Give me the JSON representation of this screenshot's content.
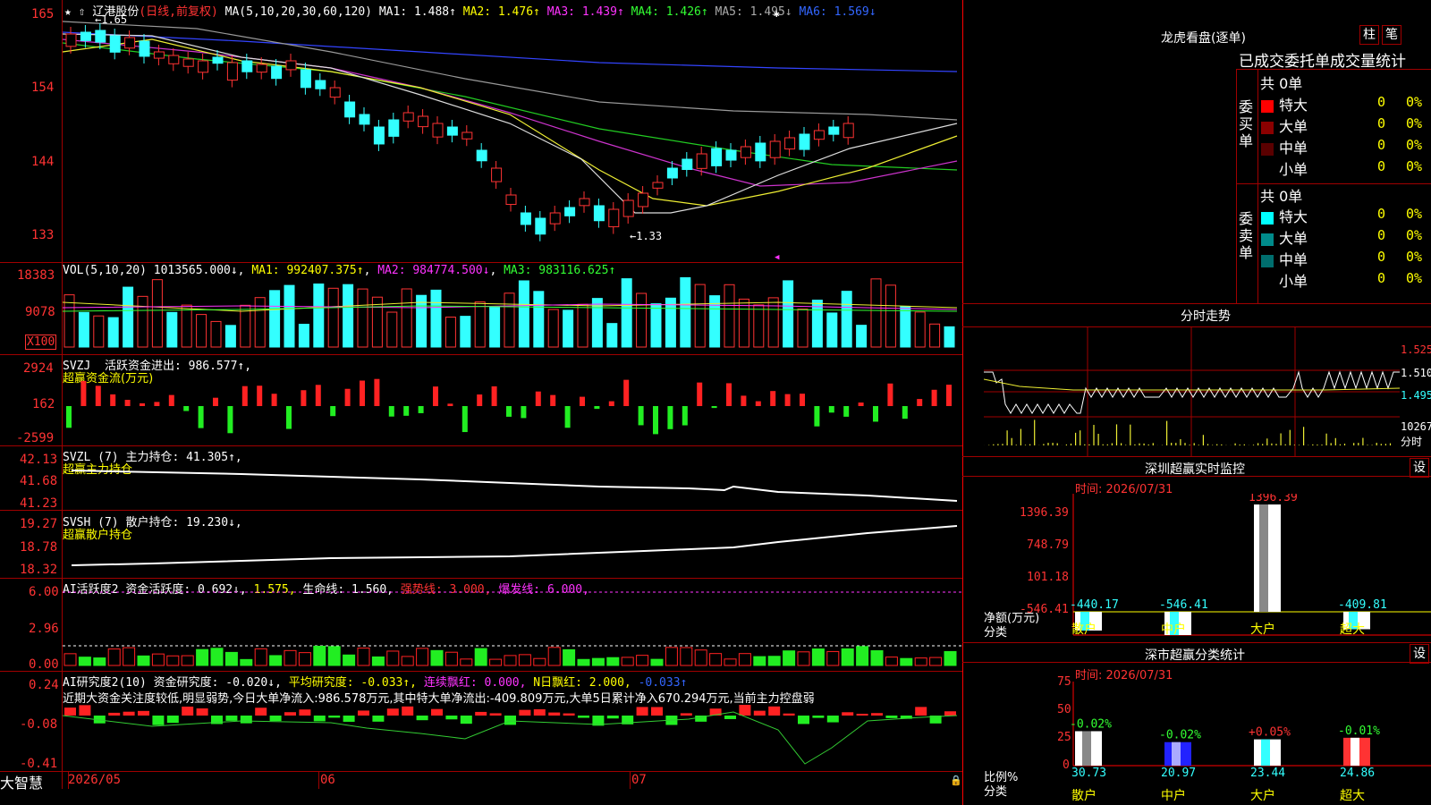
{
  "main_chart": {
    "stock_name": "辽港股份",
    "period": "(日线,前复权)",
    "ma_label": "MA(5,10,20,30,60,120)",
    "ma1": "MA1: 1.488↑",
    "ma2": "MA2: 1.476↑",
    "ma3": "MA3: 1.439↑",
    "ma4": "MA4: 1.426↑",
    "ma5": "MA5: 1.495↓",
    "ma6": "MA6: 1.569↓",
    "high_marker": "←1.65",
    "low_marker": "←1.33",
    "axis": [
      "165",
      "154",
      "144",
      "133"
    ]
  },
  "volume": {
    "title": "VOL(5,10,20)",
    "vol": "1013565.000↓",
    "ma1": "MA1: 992407.375↑",
    "ma2": "MA2: 984774.500↓",
    "ma3": "MA3: 983116.625↑",
    "axis": [
      "18383",
      "9078"
    ],
    "unit": "X100"
  },
  "svzj": {
    "title": "SVZJ",
    "name": "活跃资金进出:",
    "value": "986.577↑,",
    "subtitle": "超赢资金流(万元)",
    "axis": [
      "2924",
      "162",
      "-2599"
    ]
  },
  "svzl": {
    "title": "SVZL (7)",
    "name": "主力持仓:",
    "value": "41.305↑,",
    "subtitle": "超赢主力持仓",
    "axis": [
      "42.13",
      "41.68",
      "41.23"
    ]
  },
  "svsh": {
    "title": "SVSH (7)",
    "name": "散户持仓:",
    "value": "19.230↓,",
    "subtitle": "超赢散户持仓",
    "axis": [
      "19.27",
      "18.78",
      "18.32"
    ]
  },
  "ai_active": {
    "title": "AI活跃度2",
    "name": "资金活跃度:",
    "value": "0.692↓,",
    "value2": "1.575,",
    "life": "生命线: 1.560,",
    "strong": "强势线: 3.000,",
    "burst": "爆发线: 6.000,",
    "axis": [
      "6.00",
      "2.96",
      "0.00"
    ]
  },
  "ai_research": {
    "title": "AI研究度2(10)",
    "name": "资金研究度:",
    "value": "-0.020↓,",
    "avg": "平均研究度: -0.033↑,",
    "red_days": "连续飘红: 0.000,",
    "n_red": "N日飘红: 2.000,",
    "last": "-0.033↑",
    "comment": "近期大资金关注度较低,明显弱势,今日大单净流入:986.578万元,其中特大单净流出:-409.809万元,大单5日累计净入670.294万元,当前主力控盘弱",
    "axis": [
      "0.24",
      "-0.08",
      "-0.41"
    ]
  },
  "footer": {
    "brand": "大智慧",
    "dates": [
      "2026/05",
      "06",
      "07"
    ]
  },
  "right_panel": {
    "lhb_title": "龙虎看盘(逐单)",
    "btn_column": "柱",
    "btn_pen": "笔",
    "stats_title": "已成交委托单成交量统计",
    "buy_side": "委买单",
    "sell_side": "委卖单",
    "buy_total": "共 0单",
    "sell_total": "共 0单",
    "buy_rows": [
      {
        "label": "特大",
        "count": "0",
        "pct": "0%",
        "color": "#ff0000"
      },
      {
        "label": "大单",
        "count": "0",
        "pct": "0%",
        "color": "#8b0000"
      },
      {
        "label": "中单",
        "count": "0",
        "pct": "0%",
        "color": "#5a0000"
      },
      {
        "label": "小单",
        "count": "0",
        "pct": "0%",
        "color": "#000000"
      }
    ],
    "sell_rows": [
      {
        "label": "特大",
        "count": "0",
        "pct": "0%",
        "color": "#00ffff"
      },
      {
        "label": "大单",
        "count": "0",
        "pct": "0%",
        "color": "#008b8b"
      },
      {
        "label": "中单",
        "count": "0",
        "pct": "0%",
        "color": "#006e6e"
      },
      {
        "label": "小单",
        "count": "0",
        "pct": "0%",
        "color": "#000000"
      }
    ],
    "intraday_title": "分时走势",
    "intraday_axis": [
      "1.525",
      "1.510",
      "1.495",
      "10267",
      "分时"
    ],
    "monitor_title": "深圳超赢实时监控",
    "monitor_btn": "设",
    "monitor_time": "时间: 2026/07/31",
    "monitor_axis": [
      "1396.39",
      "748.79",
      "101.18",
      "-546.41"
    ],
    "monitor_ylabel1": "净额(万元)",
    "monitor_ylabel2": "分类",
    "monitor_bars": [
      {
        "cat": "散户",
        "value": "-440.17"
      },
      {
        "cat": "中户",
        "value": "-546.41"
      },
      {
        "cat": "大户",
        "value": "1396.39"
      },
      {
        "cat": "超大",
        "value": "-409.81"
      }
    ],
    "class_title": "深市超赢分类统计",
    "class_btn": "设",
    "class_time": "时间: 2026/07/31",
    "class_axis": [
      "75",
      "50",
      "25",
      "0"
    ],
    "class_ylabel1": "比例%",
    "class_ylabel2": "分类",
    "class_bars": [
      {
        "cat": "散户",
        "ratio": "30.73",
        "change": "-0.02%"
      },
      {
        "cat": "中户",
        "ratio": "20.97",
        "change": "-0.02%"
      },
      {
        "cat": "大户",
        "ratio": "23.44",
        "change": "+0.05%"
      },
      {
        "cat": "超大",
        "ratio": "24.86",
        "change": "-0.01%"
      }
    ]
  }
}
